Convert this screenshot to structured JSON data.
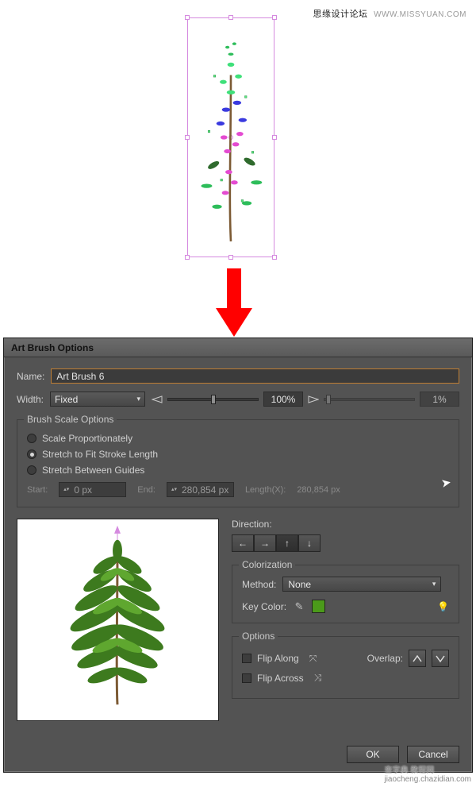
{
  "topbar": {
    "cn": "思缘设计论坛",
    "en": "WWW.MISSYUAN.COM"
  },
  "dialog": {
    "title": "Art Brush Options",
    "name_label": "Name:",
    "name_value": "Art Brush 6",
    "width_label": "Width:",
    "width_mode": "Fixed",
    "width_value": "100%",
    "width_variation": "1%",
    "scale": {
      "legend": "Brush Scale Options",
      "opt1": "Scale Proportionately",
      "opt2": "Stretch to Fit Stroke Length",
      "opt3": "Stretch Between Guides",
      "start_label": "Start:",
      "start_value": "0 px",
      "end_label": "End:",
      "end_value": "280,854 px",
      "length_label": "Length(X):",
      "length_value": "280,854 px"
    },
    "direction_label": "Direction:",
    "colorization": {
      "legend": "Colorization",
      "method_label": "Method:",
      "method_value": "None",
      "keycolor_label": "Key Color:"
    },
    "options": {
      "legend": "Options",
      "flip_along": "Flip Along",
      "flip_across": "Flip Across",
      "overlap_label": "Overlap:"
    },
    "ok": "OK",
    "cancel": "Cancel"
  },
  "watermark": {
    "brand": "查字典  教程网",
    "url": "jiaocheng.chazidian.com"
  }
}
